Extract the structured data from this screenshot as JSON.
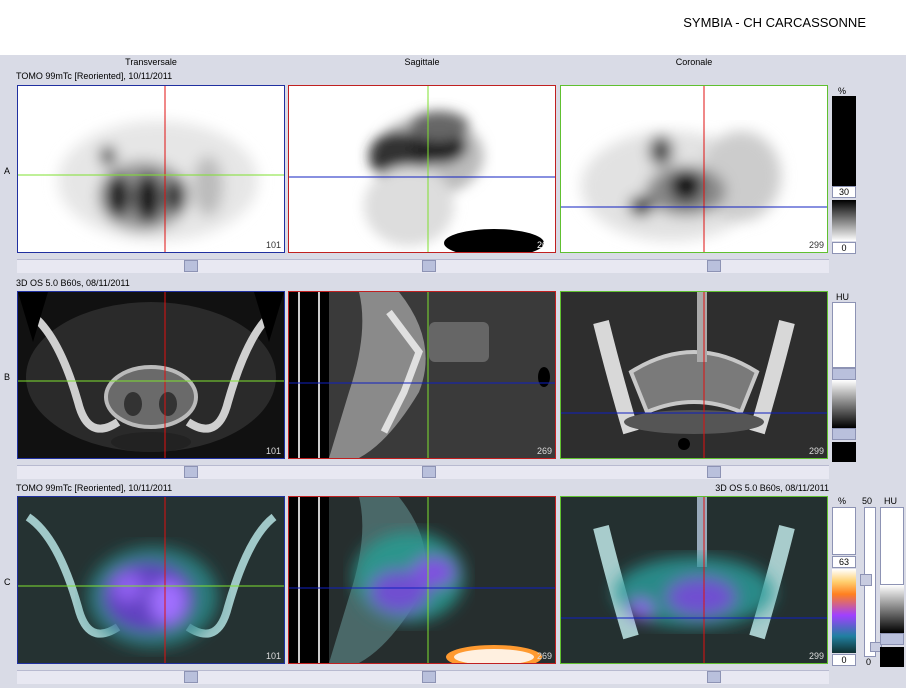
{
  "header": {
    "title": "SYMBIA - CH CARCASSONNE"
  },
  "columns": [
    "Transversale",
    "Sagittale",
    "Coronale"
  ],
  "rows": [
    {
      "label": "A",
      "series_left": "TOMO 99mTc [Reoriented], 10/11/2011",
      "series_right": "",
      "scale_unit": "%",
      "scale_top": "30",
      "scale_bottom": "0",
      "views": [
        {
          "name": "transversal",
          "slice": "101"
        },
        {
          "name": "sagittal",
          "slice": "269"
        },
        {
          "name": "coronal",
          "slice": "299"
        }
      ]
    },
    {
      "label": "B",
      "series_left": "3D  OS  5.0  B60s, 08/11/2011",
      "series_right": "",
      "scale_unit": "HU",
      "views": [
        {
          "name": "transversal",
          "slice": "101"
        },
        {
          "name": "sagittal",
          "slice": "269"
        },
        {
          "name": "coronal",
          "slice": "299"
        }
      ]
    },
    {
      "label": "C",
      "series_left": "TOMO 99mTc [Reoriented], 10/11/2011",
      "series_right": "3D  OS  5.0  B60s, 08/11/2011",
      "scale_unit": "%",
      "scale_top": "63",
      "scale_bottom": "0",
      "fusion_value": "50",
      "fusion_bottom": "0",
      "hu_unit": "HU",
      "views": [
        {
          "name": "transversal",
          "slice": "101"
        },
        {
          "name": "sagittal",
          "slice": "269"
        },
        {
          "name": "coronal",
          "slice": "299"
        }
      ]
    }
  ],
  "colors": {
    "crosshair_red": "#e01010",
    "crosshair_green": "#7fe030",
    "crosshair_blue": "#1020c0",
    "border_transversal": "#2030a0",
    "border_sagittal": "#c02020",
    "border_coronal": "#60c030"
  }
}
